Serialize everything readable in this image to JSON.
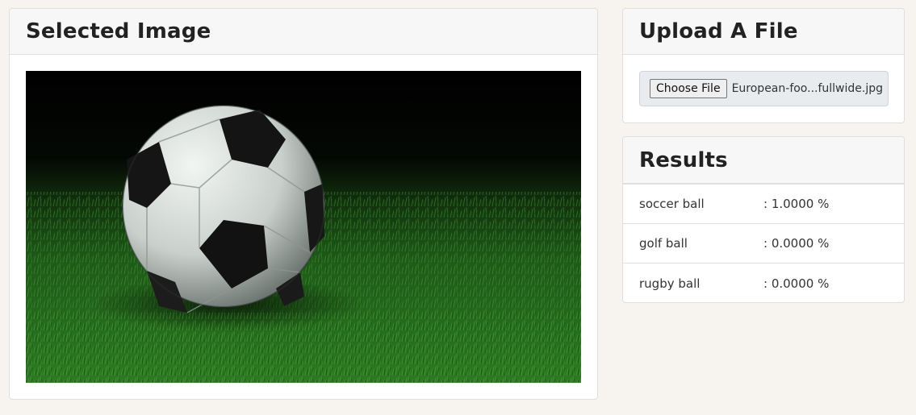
{
  "selected_image": {
    "title": "Selected Image",
    "image_subject": "soccer ball on grass"
  },
  "upload": {
    "title": "Upload A File",
    "button_label": "Choose File",
    "file_name": "European-foo...fullwide.jpg"
  },
  "results": {
    "title": "Results",
    "items": [
      {
        "label": "soccer ball",
        "value": ": 1.0000 %"
      },
      {
        "label": "golf ball",
        "value": ": 0.0000 %"
      },
      {
        "label": "rugby ball",
        "value": ": 0.0000 %"
      }
    ]
  },
  "colors": {
    "page_background": "#f7f3ee",
    "card_header": "#f7f7f7",
    "border": "#dfdfdf",
    "grass": "#2f7d25"
  }
}
